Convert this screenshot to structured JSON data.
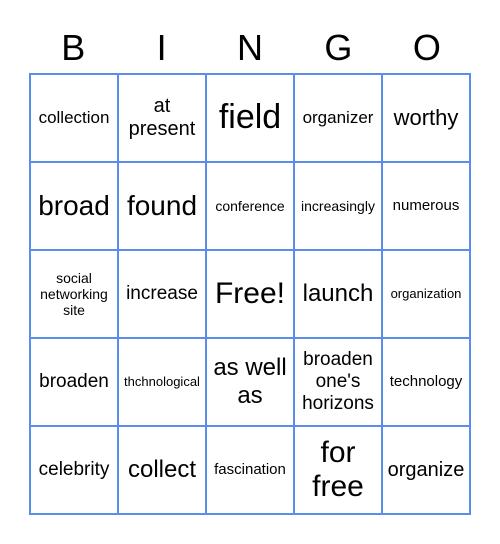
{
  "header": [
    "B",
    "I",
    "N",
    "G",
    "O"
  ],
  "cells": [
    "collection",
    "at present",
    "field",
    "organizer",
    "worthy",
    "broad",
    "found",
    "conference",
    "increasingly",
    "numerous",
    "social networking site",
    "increase",
    "Free!",
    "launch",
    "organization",
    "broaden",
    "thchnological",
    "as well as",
    "broaden one's horizons",
    "technology",
    "celebrity",
    "collect",
    "fascination",
    "for free",
    "organize"
  ],
  "grid_color": "#5b8def"
}
